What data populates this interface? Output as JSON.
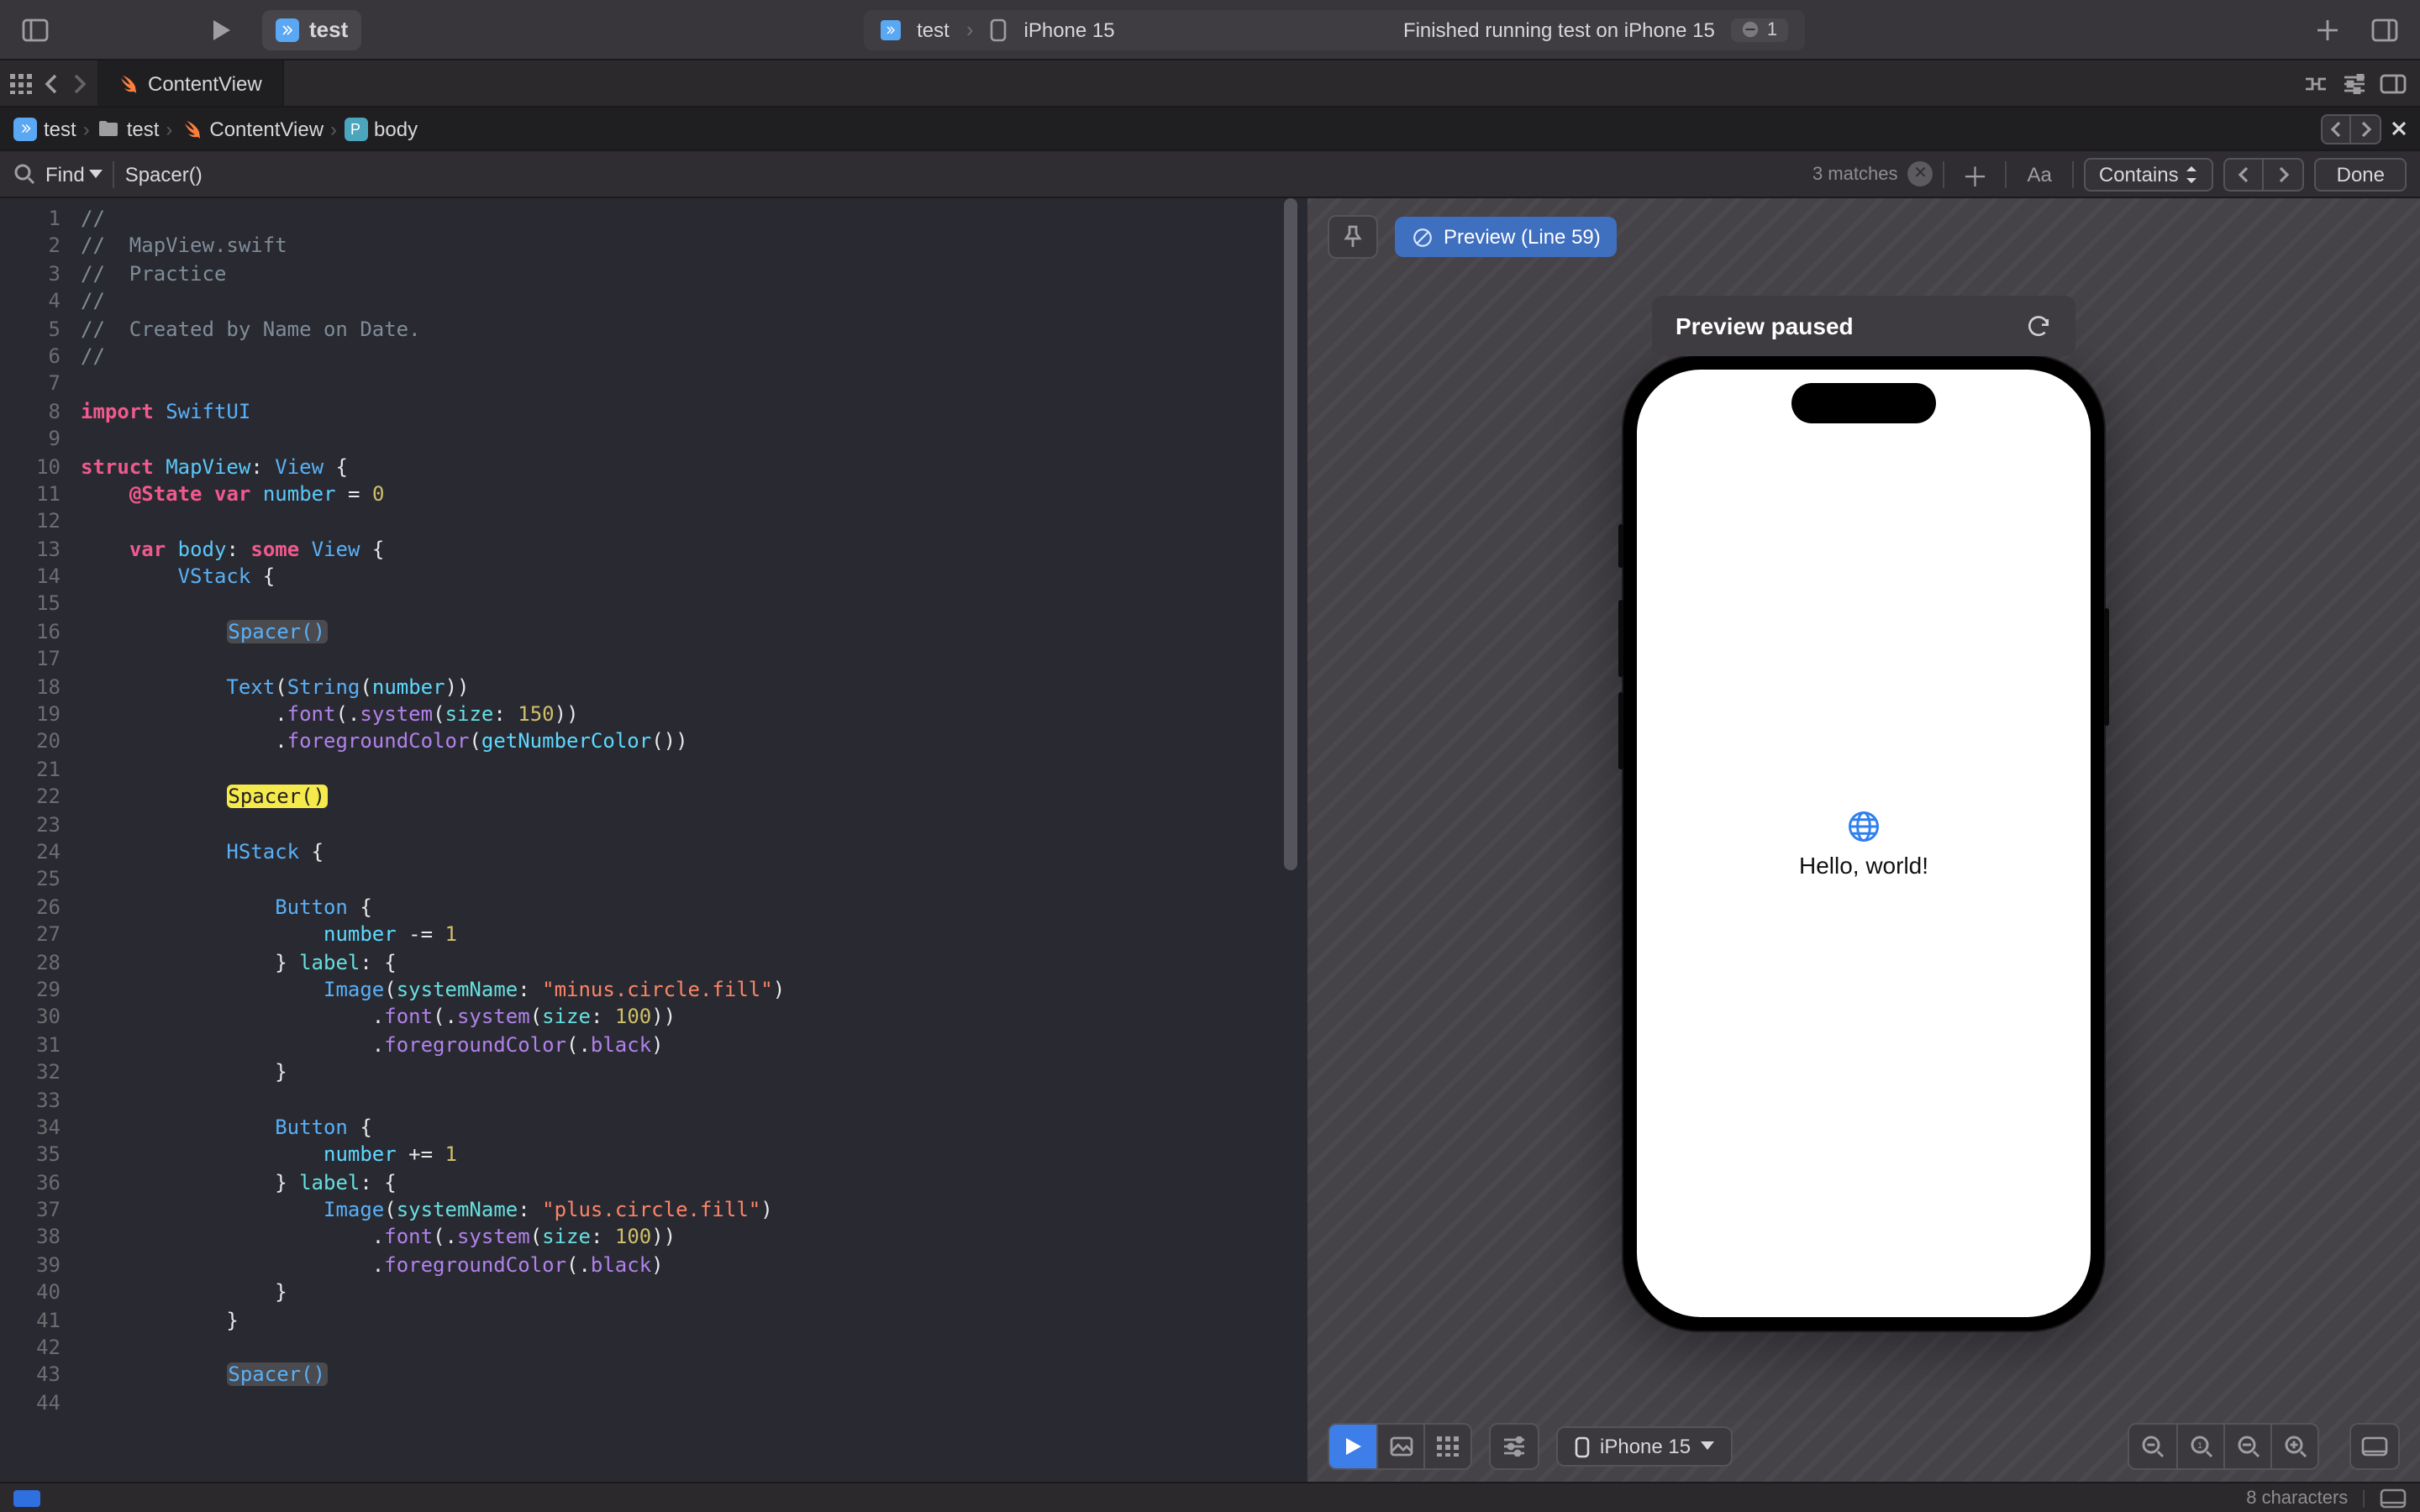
{
  "toolbar": {
    "scheme_name": "test",
    "run_target_scheme": "test",
    "run_target_device": "iPhone 15",
    "status_message": "Finished running test on iPhone 15",
    "warning_count": "1"
  },
  "tabbar": {
    "active_tab_label": "ContentView"
  },
  "breadcrumbs": {
    "items": [
      {
        "kind": "app",
        "label": "test"
      },
      {
        "kind": "folder",
        "label": "test"
      },
      {
        "kind": "swift",
        "label": "ContentView"
      },
      {
        "kind": "property",
        "label": "body"
      }
    ]
  },
  "find": {
    "mode": "Find",
    "query": "Spacer()",
    "match_text": "3 matches",
    "case_label": "Aa",
    "match_mode": "Contains",
    "done_label": "Done"
  },
  "editor": {
    "first_line": 1,
    "last_line": 44,
    "lines": [
      {
        "tokens": [
          [
            "comment",
            "//"
          ]
        ]
      },
      {
        "tokens": [
          [
            "comment",
            "//  MapView.swift"
          ]
        ]
      },
      {
        "tokens": [
          [
            "comment",
            "//  Practice"
          ]
        ]
      },
      {
        "tokens": [
          [
            "comment",
            "//"
          ]
        ]
      },
      {
        "tokens": [
          [
            "comment",
            "//  Created by Name on Date."
          ]
        ]
      },
      {
        "tokens": [
          [
            "comment",
            "//"
          ]
        ]
      },
      {
        "tokens": []
      },
      {
        "tokens": [
          [
            "kw",
            "import"
          ],
          [
            "plain",
            " "
          ],
          [
            "type",
            "SwiftUI"
          ]
        ]
      },
      {
        "tokens": []
      },
      {
        "tokens": [
          [
            "kw",
            "struct"
          ],
          [
            "plain",
            " "
          ],
          [
            "decl",
            "MapView"
          ],
          [
            "plain",
            ": "
          ],
          [
            "type",
            "View"
          ],
          [
            "plain",
            " {"
          ]
        ]
      },
      {
        "tokens": [
          [
            "plain",
            "    "
          ],
          [
            "kw",
            "@State"
          ],
          [
            "plain",
            " "
          ],
          [
            "kw",
            "var"
          ],
          [
            "plain",
            " "
          ],
          [
            "decl",
            "number"
          ],
          [
            "plain",
            " = "
          ],
          [
            "num",
            "0"
          ]
        ]
      },
      {
        "tokens": []
      },
      {
        "tokens": [
          [
            "plain",
            "    "
          ],
          [
            "kw",
            "var"
          ],
          [
            "plain",
            " "
          ],
          [
            "decl",
            "body"
          ],
          [
            "plain",
            ": "
          ],
          [
            "kw",
            "some"
          ],
          [
            "plain",
            " "
          ],
          [
            "type",
            "View"
          ],
          [
            "plain",
            " {"
          ]
        ]
      },
      {
        "tokens": [
          [
            "plain",
            "        "
          ],
          [
            "type",
            "VStack"
          ],
          [
            "plain",
            " {"
          ]
        ]
      },
      {
        "tokens": []
      },
      {
        "tokens": [
          [
            "plain",
            "            "
          ],
          [
            "hl-soft",
            "Spacer()"
          ]
        ]
      },
      {
        "tokens": []
      },
      {
        "tokens": [
          [
            "plain",
            "            "
          ],
          [
            "type",
            "Text"
          ],
          [
            "plain",
            "("
          ],
          [
            "type",
            "String"
          ],
          [
            "plain",
            "("
          ],
          [
            "member",
            "number"
          ],
          [
            "plain",
            "))"
          ]
        ]
      },
      {
        "tokens": [
          [
            "plain",
            "                ."
          ],
          [
            "func",
            "font"
          ],
          [
            "plain",
            "(."
          ],
          [
            "func",
            "system"
          ],
          [
            "plain",
            "("
          ],
          [
            "param",
            "size"
          ],
          [
            "plain",
            ": "
          ],
          [
            "num",
            "150"
          ],
          [
            "plain",
            "))"
          ]
        ]
      },
      {
        "tokens": [
          [
            "plain",
            "                ."
          ],
          [
            "func",
            "foregroundColor"
          ],
          [
            "plain",
            "("
          ],
          [
            "member",
            "getNumberColor"
          ],
          [
            "plain",
            "())"
          ]
        ]
      },
      {
        "tokens": []
      },
      {
        "tokens": [
          [
            "plain",
            "            "
          ],
          [
            "hl-active",
            "Spacer()"
          ]
        ]
      },
      {
        "tokens": []
      },
      {
        "tokens": [
          [
            "plain",
            "            "
          ],
          [
            "type",
            "HStack"
          ],
          [
            "plain",
            " {"
          ]
        ]
      },
      {
        "tokens": []
      },
      {
        "tokens": [
          [
            "plain",
            "                "
          ],
          [
            "type",
            "Button"
          ],
          [
            "plain",
            " {"
          ]
        ]
      },
      {
        "tokens": [
          [
            "plain",
            "                    "
          ],
          [
            "member",
            "number"
          ],
          [
            "plain",
            " -= "
          ],
          [
            "num",
            "1"
          ]
        ]
      },
      {
        "tokens": [
          [
            "plain",
            "                } "
          ],
          [
            "param",
            "label"
          ],
          [
            "plain",
            ": {"
          ]
        ]
      },
      {
        "tokens": [
          [
            "plain",
            "                    "
          ],
          [
            "type",
            "Image"
          ],
          [
            "plain",
            "("
          ],
          [
            "param",
            "systemName"
          ],
          [
            "plain",
            ": "
          ],
          [
            "str",
            "\"minus.circle.fill\""
          ],
          [
            "plain",
            ")"
          ]
        ]
      },
      {
        "tokens": [
          [
            "plain",
            "                        ."
          ],
          [
            "func",
            "font"
          ],
          [
            "plain",
            "(."
          ],
          [
            "func",
            "system"
          ],
          [
            "plain",
            "("
          ],
          [
            "param",
            "size"
          ],
          [
            "plain",
            ": "
          ],
          [
            "num",
            "100"
          ],
          [
            "plain",
            "))"
          ]
        ]
      },
      {
        "tokens": [
          [
            "plain",
            "                        ."
          ],
          [
            "func",
            "foregroundColor"
          ],
          [
            "plain",
            "(."
          ],
          [
            "func",
            "black"
          ],
          [
            "plain",
            ")"
          ]
        ]
      },
      {
        "tokens": [
          [
            "plain",
            "                }"
          ]
        ]
      },
      {
        "tokens": []
      },
      {
        "tokens": [
          [
            "plain",
            "                "
          ],
          [
            "type",
            "Button"
          ],
          [
            "plain",
            " {"
          ]
        ]
      },
      {
        "tokens": [
          [
            "plain",
            "                    "
          ],
          [
            "member",
            "number"
          ],
          [
            "plain",
            " += "
          ],
          [
            "num",
            "1"
          ]
        ]
      },
      {
        "tokens": [
          [
            "plain",
            "                } "
          ],
          [
            "param",
            "label"
          ],
          [
            "plain",
            ": {"
          ]
        ]
      },
      {
        "tokens": [
          [
            "plain",
            "                    "
          ],
          [
            "type",
            "Image"
          ],
          [
            "plain",
            "("
          ],
          [
            "param",
            "systemName"
          ],
          [
            "plain",
            ": "
          ],
          [
            "str",
            "\"plus.circle.fill\""
          ],
          [
            "plain",
            ")"
          ]
        ]
      },
      {
        "tokens": [
          [
            "plain",
            "                        ."
          ],
          [
            "func",
            "font"
          ],
          [
            "plain",
            "(."
          ],
          [
            "func",
            "system"
          ],
          [
            "plain",
            "("
          ],
          [
            "param",
            "size"
          ],
          [
            "plain",
            ": "
          ],
          [
            "num",
            "100"
          ],
          [
            "plain",
            "))"
          ]
        ]
      },
      {
        "tokens": [
          [
            "plain",
            "                        ."
          ],
          [
            "func",
            "foregroundColor"
          ],
          [
            "plain",
            "(."
          ],
          [
            "func",
            "black"
          ],
          [
            "plain",
            ")"
          ]
        ]
      },
      {
        "tokens": [
          [
            "plain",
            "                }"
          ]
        ]
      },
      {
        "tokens": [
          [
            "plain",
            "            }"
          ]
        ]
      },
      {
        "tokens": []
      },
      {
        "tokens": [
          [
            "plain",
            "            "
          ],
          [
            "hl-soft",
            "Spacer()"
          ]
        ]
      },
      {
        "tokens": []
      }
    ]
  },
  "preview": {
    "pill_label": "Preview (Line 59)",
    "paused_banner": "Preview paused",
    "hello_text": "Hello, world!",
    "device_selector": "iPhone 15"
  },
  "statusbar": {
    "selection": "8 characters"
  }
}
